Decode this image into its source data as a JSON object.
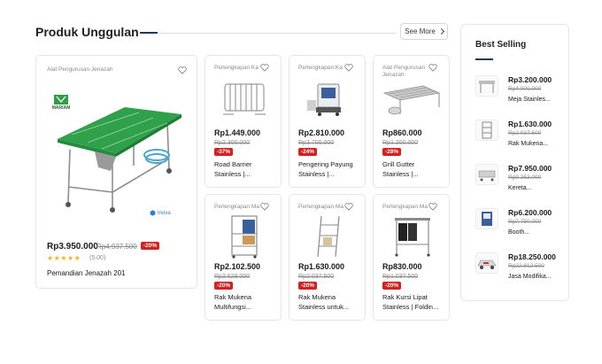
{
  "section": {
    "title": "Produk Unggulan",
    "see_more": "See More"
  },
  "featured": {
    "category": "Alat Pengurusan Jenazah",
    "brand_logo": "MARIAM",
    "brand_mark": "Inova",
    "price": "Rp3.950.000",
    "old_price": "Rp4.937.500",
    "discount": "-20%",
    "stars": "★★★★★",
    "rating": "(5.00)",
    "name": "Pemandian Jenazah 201"
  },
  "products": [
    {
      "category": "Perlengkapan Ka",
      "price": "Rp1.449.000",
      "old_price": "Rp2.300.000",
      "discount": "-37%",
      "name_1": "Road Barrier",
      "name_2": "Stainless |..."
    },
    {
      "category": "Perlengkapan Ka",
      "price": "Rp2.810.000",
      "old_price": "Rp3.700.000",
      "discount": "-24%",
      "name_1": "Pengering Payung",
      "name_2": "Stainless |..."
    },
    {
      "category": "Alat Pengurusan Jenazah",
      "price": "Rp860.000",
      "old_price": "Rp1.200.000",
      "discount": "-28%",
      "name_1": "Grill Gutter",
      "name_2": "Stainless |..."
    },
    {
      "category": "Perlengkapan Ma",
      "price": "Rp2.102.500",
      "old_price": "Rp2.629.000",
      "discount": "-20%",
      "name_1": "Rak Mukena",
      "name_2": "Multifungsi..."
    },
    {
      "category": "Perlengkapan Ma",
      "price": "Rp1.630.000",
      "old_price": "Rp2.037.500",
      "discount": "-20%",
      "name_1": "Rak Mukena",
      "name_2": "Stainless untuk..."
    },
    {
      "category": "Perlengkapan Ma",
      "price": "Rp830.000",
      "old_price": "Rp1.037.500",
      "discount": "-20%",
      "name_1": "Rak Kursi Lipat",
      "name_2": "Stainless | Foldin..."
    }
  ],
  "best_selling": {
    "title": "Best Selling",
    "items": [
      {
        "price": "Rp3.200.000",
        "old_price": "Rp4.000.000",
        "name": "Meja Stainles..."
      },
      {
        "price": "Rp1.630.000",
        "old_price": "Rp2.037.500",
        "name": "Rak Mukena..."
      },
      {
        "price": "Rp7.950.000",
        "old_price": "Rp9.353.000",
        "name": "Kereta..."
      },
      {
        "price": "Rp6.200.000",
        "old_price": "Rp7.750.000",
        "name": "Booth..."
      },
      {
        "price": "Rp18.250.000",
        "old_price": "Rp22.812.500",
        "name": "Jasa Modifika..."
      }
    ]
  },
  "colors": {
    "discount": "#d61f1f",
    "accent": "#1f3a5f",
    "star": "#f2b01e",
    "table_green": "#2fa14b"
  }
}
